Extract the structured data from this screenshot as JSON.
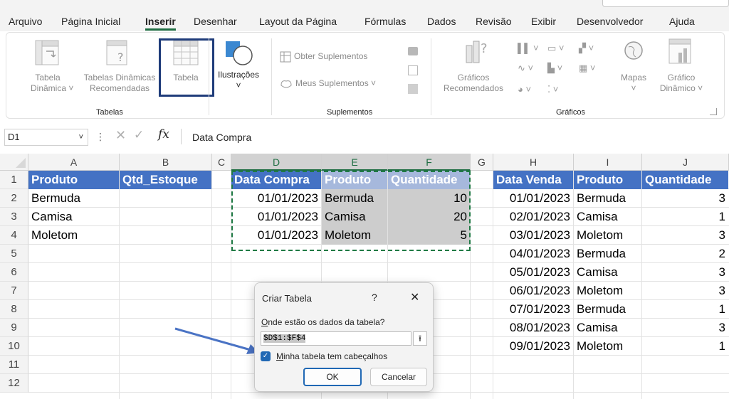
{
  "menu": {
    "tabs": [
      {
        "label": "Arquivo",
        "active": false
      },
      {
        "label": "Página Inicial",
        "active": false
      },
      {
        "label": "Inserir",
        "active": true
      },
      {
        "label": "Desenhar",
        "active": false
      },
      {
        "label": "Layout da Página",
        "active": false
      },
      {
        "label": "Fórmulas",
        "active": false
      },
      {
        "label": "Dados",
        "active": false
      },
      {
        "label": "Revisão",
        "active": false
      },
      {
        "label": "Exibir",
        "active": false
      },
      {
        "label": "Desenvolvedor",
        "active": false
      },
      {
        "label": "Ajuda",
        "active": false
      }
    ]
  },
  "ribbon": {
    "tabelas_group": {
      "label": "Tabelas",
      "tabela_dinamica": {
        "line1": "Tabela",
        "line2": "Dinâmica ˅"
      },
      "tabelas_recomendadas": {
        "line1": "Tabelas Dinâmicas",
        "line2": "Recomendadas"
      },
      "tabela": {
        "label": "Tabela"
      }
    },
    "ilustracoes": {
      "label": "Ilustrações",
      "chevron": "˅"
    },
    "suplementos_group": {
      "label": "Suplementos",
      "obter": "Obter Suplementos",
      "meus": "Meus Suplementos ˅"
    },
    "graficos_group": {
      "label": "Gráficos",
      "recomendados": {
        "line1": "Gráficos",
        "line2": "Recomendados"
      },
      "mapas": {
        "label": "Mapas",
        "chevron": "˅"
      },
      "grafico_dinamico": {
        "line1": "Gráfico",
        "line2": "Dinâmico ˅"
      }
    }
  },
  "formula_bar": {
    "name_box": "D1",
    "dropdown_arrow": "˅",
    "dots": "⋮",
    "cancel": "✕",
    "enter": "✓",
    "fx": "fx",
    "content": "Data Compra"
  },
  "grid": {
    "columns": [
      "A",
      "B",
      "C",
      "D",
      "E",
      "F",
      "G",
      "H",
      "I",
      "J"
    ],
    "rows": [
      "1",
      "2",
      "3",
      "4",
      "5",
      "6",
      "7",
      "8",
      "9",
      "10",
      "11",
      "12"
    ],
    "table1": {
      "headers": [
        "Produto",
        "Qtd_Estoque"
      ],
      "rows": [
        [
          "Bermuda",
          ""
        ],
        [
          "Camisa",
          ""
        ],
        [
          "Moletom",
          ""
        ]
      ]
    },
    "table2": {
      "headers": [
        "Data Compra",
        "Produto",
        "Quantidade"
      ],
      "rows": [
        [
          "01/01/2023",
          "Bermuda",
          "10"
        ],
        [
          "01/01/2023",
          "Camisa",
          "20"
        ],
        [
          "01/01/2023",
          "Moletom",
          "5"
        ]
      ]
    },
    "table3": {
      "headers": [
        "Data Venda",
        "Produto",
        "Quantidade"
      ],
      "rows": [
        [
          "01/01/2023",
          "Bermuda",
          "3"
        ],
        [
          "02/01/2023",
          "Camisa",
          "1"
        ],
        [
          "03/01/2023",
          "Moletom",
          "3"
        ],
        [
          "04/01/2023",
          "Bermuda",
          "2"
        ],
        [
          "05/01/2023",
          "Camisa",
          "3"
        ],
        [
          "06/01/2023",
          "Moletom",
          "3"
        ],
        [
          "07/01/2023",
          "Bermuda",
          "1"
        ],
        [
          "08/01/2023",
          "Camisa",
          "3"
        ],
        [
          "09/01/2023",
          "Moletom",
          "1"
        ]
      ]
    }
  },
  "dialog": {
    "title": "Criar Tabela",
    "help": "?",
    "close": "✕",
    "question_first": "O",
    "question_rest": "nde estão os dados da tabela?",
    "range_value": "$D$1:$F$4",
    "collapse_icon": "⭱",
    "checkbox_checked": true,
    "checkbox_mark": "✓",
    "checkbox_label_first": "M",
    "checkbox_label_rest": "inha tabela tem cabeçalhos",
    "ok_label": "OK",
    "cancel_label": "Cancelar"
  },
  "colors": {
    "header_blue": "#4472c4",
    "excel_green": "#1f6e43",
    "highlight_box": "#1f3c7a",
    "annotation_arrow": "#4a73c4",
    "checkbox_blue": "#2068b4"
  }
}
